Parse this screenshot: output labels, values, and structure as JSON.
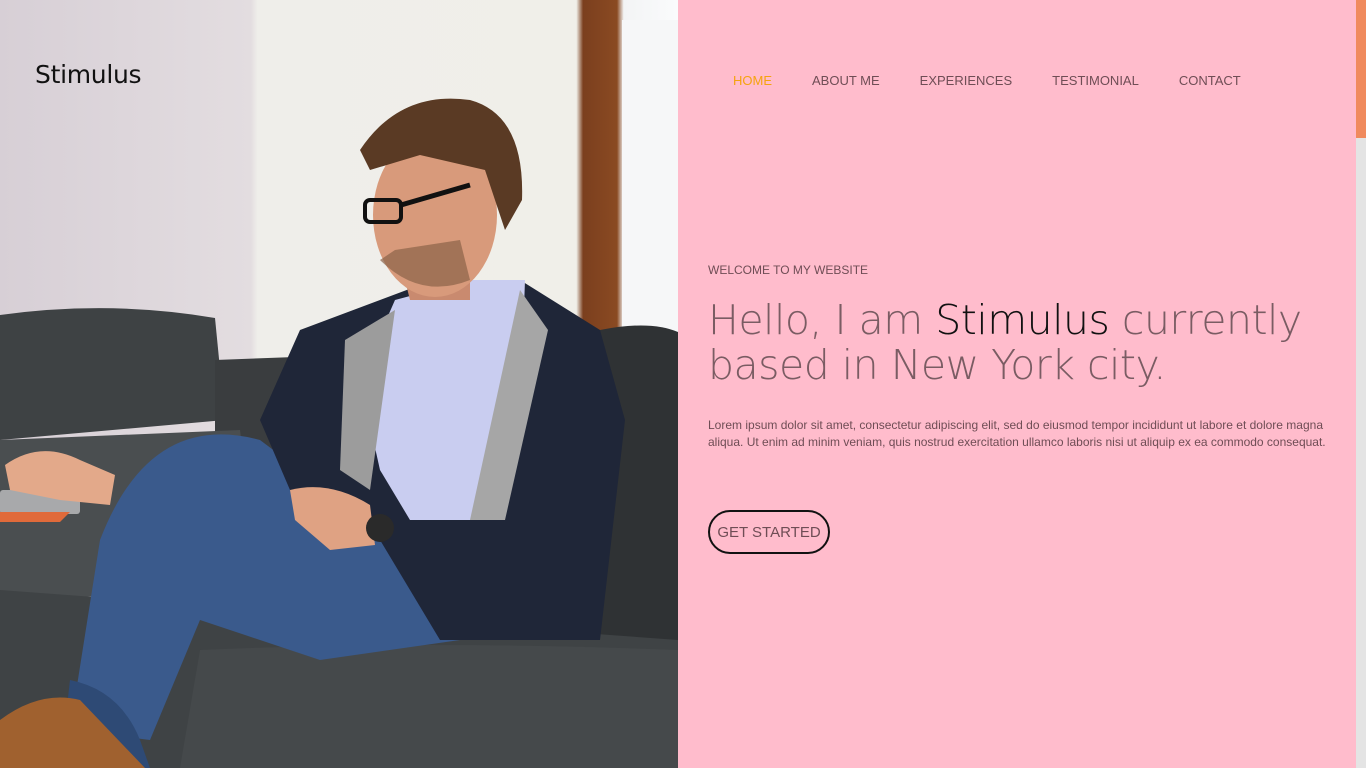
{
  "brand": "Stimulus",
  "nav": {
    "items": [
      {
        "label": "HOME",
        "active": true
      },
      {
        "label": "ABOUT ME",
        "active": false
      },
      {
        "label": "EXPERIENCES",
        "active": false
      },
      {
        "label": "TESTIMONIAL",
        "active": false
      },
      {
        "label": "CONTACT",
        "active": false
      }
    ],
    "active_color": "#f5a30f"
  },
  "hero": {
    "eyebrow": "WELCOME TO MY WEBSITE",
    "headline_before": "Hello, I am ",
    "headline_name": "Stimulus",
    "headline_after": " currently based in New York city.",
    "description": "Lorem ipsum dolor sit amet, consectetur adipiscing elit, sed do eiusmod tempor incididunt ut labore et dolore magna aliqua. Ut enim ad minim veniam, quis nostrud exercitation ullamco laboris nisi ut aliquip ex ea commodo consequat.",
    "cta_label": "GET STARTED",
    "photo": "man-sitting-on-couch-with-laptop-photo"
  },
  "colors": {
    "background": "#ffbccc",
    "text": "#6f4d55",
    "accent": "#f08a5d"
  }
}
